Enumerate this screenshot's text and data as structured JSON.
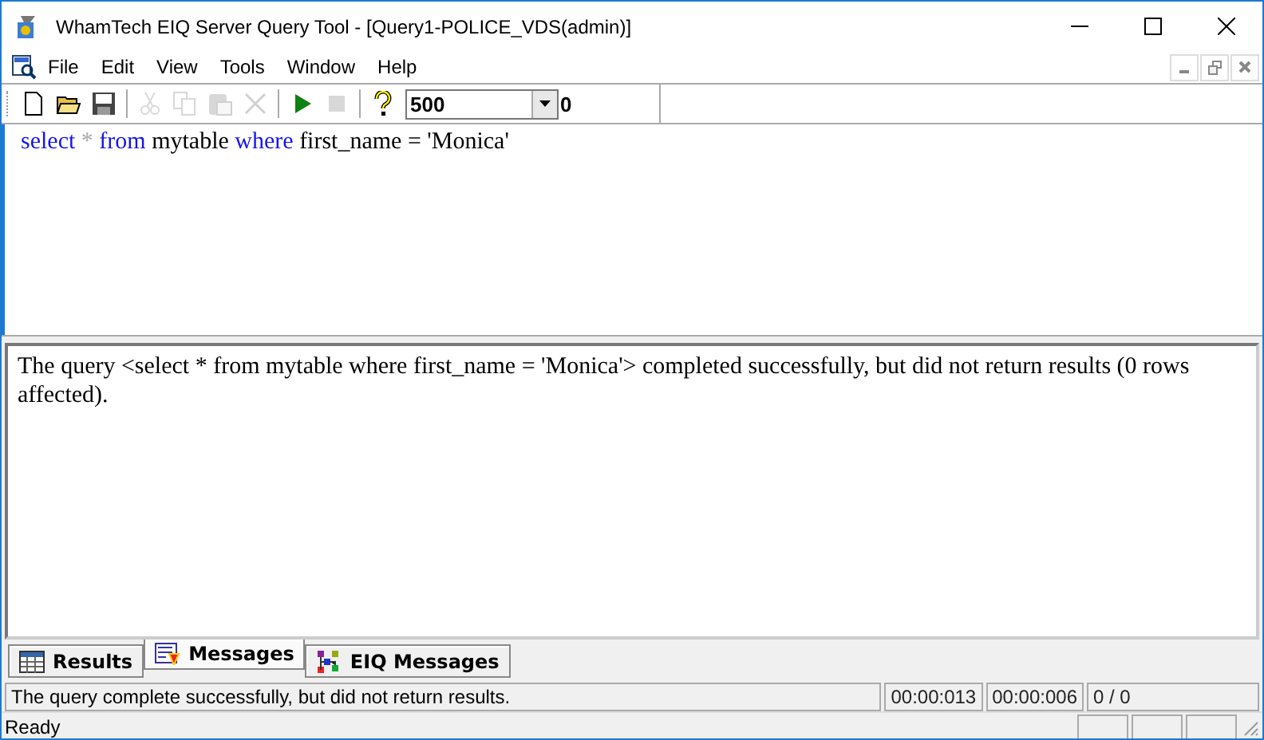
{
  "window": {
    "title": "WhamTech EIQ Server Query Tool - [Query1-POLICE_VDS(admin)]"
  },
  "menu": [
    "File",
    "Edit",
    "View",
    "Tools",
    "Window",
    "Help"
  ],
  "toolbar": {
    "buttons": [
      {
        "kind": "new",
        "disabled": false
      },
      {
        "kind": "open",
        "disabled": false
      },
      {
        "kind": "save",
        "disabled": false
      },
      {
        "kind": "sep"
      },
      {
        "kind": "cut",
        "disabled": true
      },
      {
        "kind": "copy",
        "disabled": true
      },
      {
        "kind": "paste",
        "disabled": true
      },
      {
        "kind": "delete",
        "disabled": true
      },
      {
        "kind": "sep"
      },
      {
        "kind": "run",
        "disabled": false
      },
      {
        "kind": "stop",
        "disabled": true
      },
      {
        "kind": "sep"
      },
      {
        "kind": "help",
        "disabled": false
      }
    ],
    "row_limit": "500",
    "count": "0"
  },
  "query": [
    {
      "kind": "keyword",
      "text": "select"
    },
    {
      "kind": "operator",
      "text": "*"
    },
    {
      "kind": "keyword",
      "text": "from"
    },
    {
      "kind": "plain",
      "text": "mytable"
    },
    {
      "kind": "keyword",
      "text": "where"
    },
    {
      "kind": "plain",
      "text": "first_name = 'Monica'"
    }
  ],
  "message": "The query <select * from mytable where first_name = 'Monica'> completed successfully, but did not return results (0 rows affected).",
  "tabs": [
    {
      "label": "Results",
      "kind": "grid",
      "selected": false
    },
    {
      "label": "Messages",
      "kind": "messages",
      "selected": true
    },
    {
      "label": "EIQ Messages",
      "kind": "tree",
      "selected": false
    }
  ],
  "status": {
    "message": "The query complete successfully, but did not return results.",
    "times": [
      "00:00:013",
      "00:00:006",
      "0 / 0"
    ],
    "state": "Ready"
  }
}
